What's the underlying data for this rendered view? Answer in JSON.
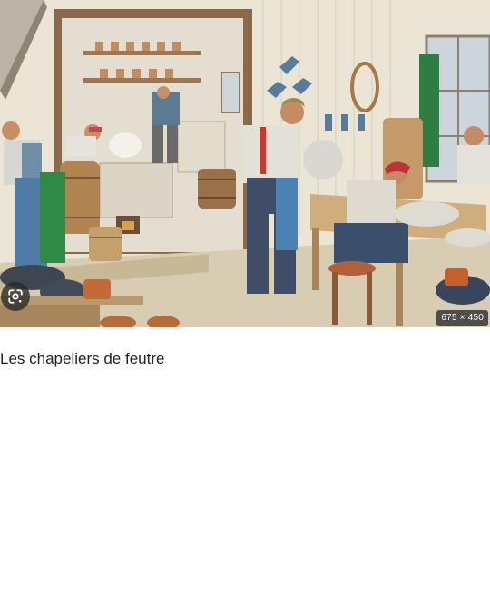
{
  "image": {
    "dimensions_label": "675 × 450",
    "lens_icon": "google-lens-icon"
  },
  "caption": "Les chapeliers de feutre",
  "colors": {
    "caption_text": "#202124",
    "badge_background": "#323232",
    "badge_text": "#ffffff",
    "page_background": "#ffffff"
  }
}
